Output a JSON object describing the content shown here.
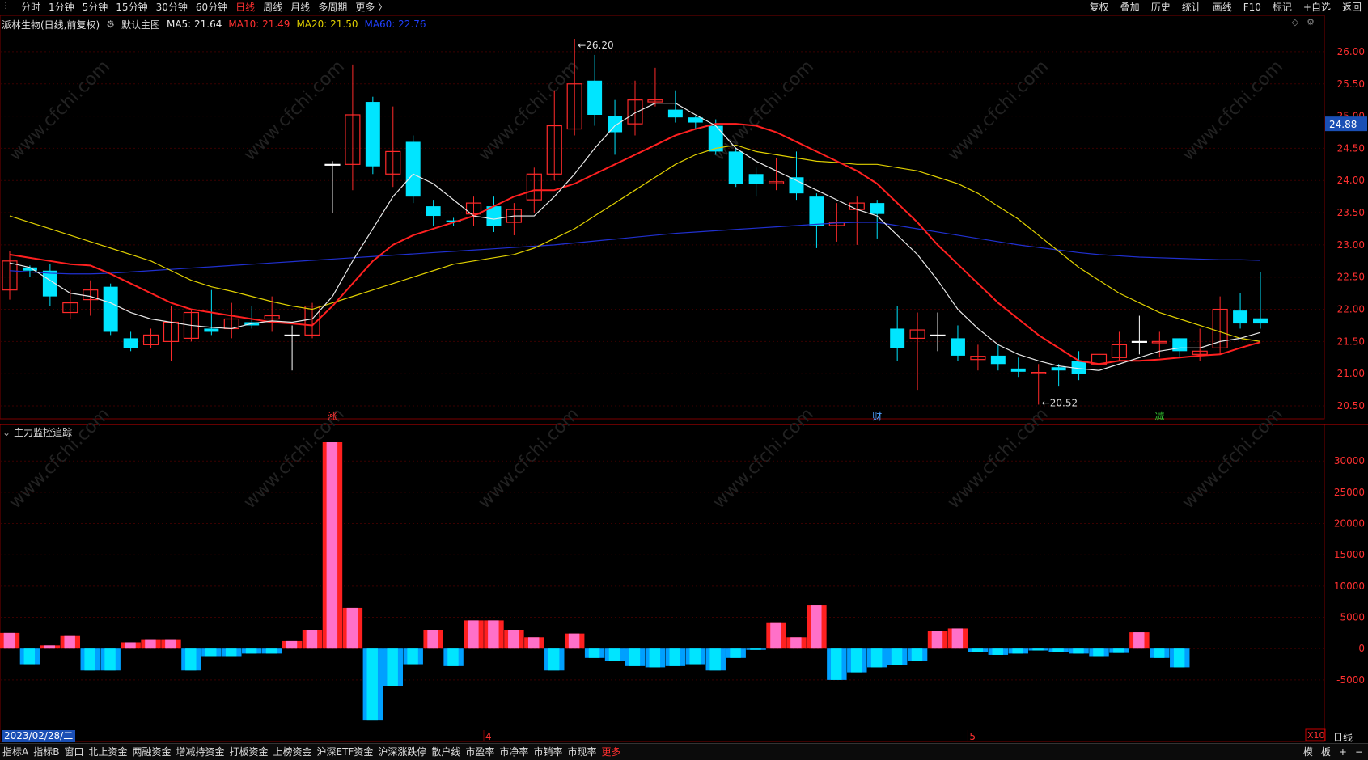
{
  "toolbar": {
    "left_items": [
      "分时",
      "1分钟",
      "5分钟",
      "15分钟",
      "30分钟",
      "60分钟",
      "日线",
      "周线",
      "月线",
      "多周期",
      "更多 〉"
    ],
    "active_item": "日线",
    "right_items": [
      "复权",
      "叠加",
      "历史",
      "统计",
      "画线",
      "F10",
      "标记",
      "+自选",
      "返回"
    ]
  },
  "legend": {
    "stock": "派林生物(日线,前复权)",
    "main": "默认主图",
    "ma5": "MA5: 21.64",
    "ma10": "MA10: 21.49",
    "ma20": "MA20: 21.50",
    "ma60": "MA60: 22.76"
  },
  "indicator_title": "主力监控追踪",
  "bottom_tabs": [
    "指标A",
    "指标B",
    "窗口",
    "北上资金",
    "两融资金",
    "增减持资金",
    "打板资金",
    "上榜资金",
    "沪深ETF资金",
    "沪深涨跌停",
    "散户线",
    "市盈率",
    "市净率",
    "市销率",
    "市现率",
    "更多"
  ],
  "bottom_right": [
    "模",
    "板",
    "+",
    "−"
  ],
  "date_label": "2023/02/28/二",
  "period_label": "日线",
  "x10_label": "X10",
  "colors": {
    "up": "#ff2a2a",
    "down": "#00e5ff",
    "ma5": "#e8e8e8",
    "ma10": "#ff2020",
    "ma20": "#e0d000",
    "ma60": "#2030d0",
    "bar_red": "#ff2020",
    "bar_pink": "#ff70c8",
    "bar_blue": "#00a0ff",
    "bar_cyan": "#00e5ff"
  },
  "chart_data": {
    "type": "candlestick",
    "price_axis": {
      "min": 20.4,
      "max": 26.2,
      "ticks": [
        "26.00",
        "25.50",
        "25.00",
        "24.50",
        "24.00",
        "23.50",
        "23.00",
        "22.50",
        "22.00",
        "21.50",
        "21.00",
        "20.50"
      ],
      "current": "24.88"
    },
    "annotations": {
      "high": "26.20",
      "low": "20.52"
    },
    "month_labels": [
      "4",
      "5"
    ],
    "event_markers": [
      "涨",
      "财",
      "减"
    ],
    "candles": [
      {
        "o": 22.3,
        "c": 22.75,
        "h": 22.9,
        "l": 22.15
      },
      {
        "o": 22.65,
        "c": 22.6,
        "h": 22.68,
        "l": 22.5
      },
      {
        "o": 22.6,
        "c": 22.2,
        "h": 22.7,
        "l": 22.05
      },
      {
        "o": 21.95,
        "c": 22.1,
        "h": 22.3,
        "l": 21.85
      },
      {
        "o": 22.15,
        "c": 22.3,
        "h": 22.45,
        "l": 21.9
      },
      {
        "o": 22.35,
        "c": 21.65,
        "h": 22.4,
        "l": 21.6
      },
      {
        "o": 21.55,
        "c": 21.4,
        "h": 21.65,
        "l": 21.35
      },
      {
        "o": 21.45,
        "c": 21.6,
        "h": 21.7,
        "l": 21.4
      },
      {
        "o": 21.5,
        "c": 21.8,
        "h": 22.05,
        "l": 21.2
      },
      {
        "o": 21.55,
        "c": 21.95,
        "h": 22.0,
        "l": 21.5
      },
      {
        "o": 21.7,
        "c": 21.65,
        "h": 22.3,
        "l": 21.6
      },
      {
        "o": 21.7,
        "c": 21.85,
        "h": 22.1,
        "l": 21.55
      },
      {
        "o": 21.8,
        "c": 21.75,
        "h": 22.05,
        "l": 21.7
      },
      {
        "o": 21.85,
        "c": 21.9,
        "h": 22.2,
        "l": 21.65
      },
      {
        "o": 21.6,
        "c": 21.6,
        "h": 21.75,
        "l": 21.05
      },
      {
        "o": 21.6,
        "c": 22.05,
        "h": 22.1,
        "l": 21.55
      },
      {
        "o": 24.25,
        "c": 24.25,
        "h": 24.3,
        "l": 23.5
      },
      {
        "o": 24.25,
        "c": 25.02,
        "h": 25.8,
        "l": 23.85
      },
      {
        "o": 25.22,
        "c": 24.22,
        "h": 25.3,
        "l": 24.1
      },
      {
        "o": 24.1,
        "c": 24.45,
        "h": 25.15,
        "l": 23.9
      },
      {
        "o": 24.6,
        "c": 23.75,
        "h": 24.7,
        "l": 23.65
      },
      {
        "o": 23.6,
        "c": 23.45,
        "h": 23.7,
        "l": 23.3
      },
      {
        "o": 23.38,
        "c": 23.35,
        "h": 23.42,
        "l": 23.3
      },
      {
        "o": 23.48,
        "c": 23.65,
        "h": 23.75,
        "l": 23.3
      },
      {
        "o": 23.6,
        "c": 23.3,
        "h": 23.75,
        "l": 23.2
      },
      {
        "o": 23.35,
        "c": 23.55,
        "h": 23.65,
        "l": 23.15
      },
      {
        "o": 23.7,
        "c": 24.1,
        "h": 24.2,
        "l": 23.5
      },
      {
        "o": 24.1,
        "c": 24.85,
        "h": 25.4,
        "l": 24.0
      },
      {
        "o": 24.8,
        "c": 25.5,
        "h": 26.2,
        "l": 24.7
      },
      {
        "o": 25.55,
        "c": 25.02,
        "h": 25.95,
        "l": 24.85
      },
      {
        "o": 25.0,
        "c": 24.75,
        "h": 25.25,
        "l": 24.4
      },
      {
        "o": 24.88,
        "c": 25.25,
        "h": 25.55,
        "l": 24.7
      },
      {
        "o": 25.22,
        "c": 25.25,
        "h": 25.75,
        "l": 25.15
      },
      {
        "o": 25.1,
        "c": 24.98,
        "h": 25.4,
        "l": 24.9
      },
      {
        "o": 24.98,
        "c": 24.9,
        "h": 25.0,
        "l": 24.8
      },
      {
        "o": 24.85,
        "c": 24.45,
        "h": 24.95,
        "l": 24.4
      },
      {
        "o": 24.45,
        "c": 23.95,
        "h": 24.5,
        "l": 23.9
      },
      {
        "o": 24.1,
        "c": 23.95,
        "h": 24.2,
        "l": 23.75
      },
      {
        "o": 23.95,
        "c": 23.98,
        "h": 24.35,
        "l": 23.85
      },
      {
        "o": 24.05,
        "c": 23.8,
        "h": 24.45,
        "l": 23.7
      },
      {
        "o": 23.75,
        "c": 23.3,
        "h": 23.8,
        "l": 22.95
      },
      {
        "o": 23.3,
        "c": 23.35,
        "h": 23.65,
        "l": 23.05
      },
      {
        "o": 23.55,
        "c": 23.65,
        "h": 23.75,
        "l": 23.0
      },
      {
        "o": 23.65,
        "c": 23.48,
        "h": 23.7,
        "l": 23.1
      },
      {
        "o": 21.7,
        "c": 21.4,
        "h": 22.05,
        "l": 21.2
      },
      {
        "o": 21.55,
        "c": 21.68,
        "h": 21.95,
        "l": 20.75
      },
      {
        "o": 21.6,
        "c": 21.6,
        "h": 21.95,
        "l": 21.35
      },
      {
        "o": 21.55,
        "c": 21.28,
        "h": 21.75,
        "l": 21.2
      },
      {
        "o": 21.22,
        "c": 21.27,
        "h": 21.45,
        "l": 21.05
      },
      {
        "o": 21.28,
        "c": 21.15,
        "h": 21.45,
        "l": 21.05
      },
      {
        "o": 21.08,
        "c": 21.03,
        "h": 21.25,
        "l": 20.95
      },
      {
        "o": 21.0,
        "c": 21.02,
        "h": 21.15,
        "l": 20.52
      },
      {
        "o": 21.1,
        "c": 21.05,
        "h": 21.15,
        "l": 20.8
      },
      {
        "o": 21.2,
        "c": 21.0,
        "h": 21.35,
        "l": 20.9
      },
      {
        "o": 21.15,
        "c": 21.3,
        "h": 21.35,
        "l": 21.05
      },
      {
        "o": 21.25,
        "c": 21.45,
        "h": 21.65,
        "l": 21.2
      },
      {
        "o": 21.5,
        "c": 21.5,
        "h": 21.9,
        "l": 21.3
      },
      {
        "o": 21.48,
        "c": 21.5,
        "h": 21.65,
        "l": 21.25
      },
      {
        "o": 21.55,
        "c": 21.35,
        "h": 21.55,
        "l": 21.25
      },
      {
        "o": 21.3,
        "c": 21.35,
        "h": 21.7,
        "l": 21.2
      },
      {
        "o": 21.4,
        "c": 22.0,
        "h": 22.2,
        "l": 21.3
      },
      {
        "o": 21.98,
        "c": 21.78,
        "h": 22.25,
        "l": 21.7
      },
      {
        "o": 21.86,
        "c": 21.78,
        "h": 22.58,
        "l": 21.7
      }
    ],
    "ma5": [
      22.72,
      22.65,
      22.45,
      22.25,
      22.2,
      22.1,
      21.95,
      21.85,
      21.8,
      21.75,
      21.72,
      21.7,
      21.78,
      21.82,
      21.8,
      21.85,
      22.2,
      22.75,
      23.25,
      23.75,
      24.1,
      23.95,
      23.7,
      23.45,
      23.4,
      23.45,
      23.45,
      23.75,
      24.1,
      24.5,
      24.85,
      25.05,
      25.2,
      25.2,
      25.02,
      24.85,
      24.5,
      24.3,
      24.15,
      24.0,
      23.85,
      23.7,
      23.55,
      23.45,
      23.15,
      22.85,
      22.45,
      22.0,
      21.7,
      21.45,
      21.3,
      21.2,
      21.12,
      21.08,
      21.05,
      21.15,
      21.25,
      21.35,
      21.4,
      21.4,
      21.5,
      21.55,
      21.64
    ],
    "ma10": [
      22.85,
      22.8,
      22.75,
      22.7,
      22.68,
      22.55,
      22.4,
      22.25,
      22.1,
      22.0,
      21.95,
      21.9,
      21.85,
      21.8,
      21.78,
      21.75,
      22.05,
      22.4,
      22.75,
      23.0,
      23.15,
      23.25,
      23.35,
      23.45,
      23.6,
      23.75,
      23.85,
      23.85,
      23.95,
      24.1,
      24.25,
      24.4,
      24.55,
      24.7,
      24.8,
      24.88,
      24.88,
      24.85,
      24.75,
      24.6,
      24.45,
      24.3,
      24.15,
      23.95,
      23.65,
      23.35,
      23.0,
      22.7,
      22.4,
      22.1,
      21.85,
      21.6,
      21.4,
      21.2,
      21.15,
      21.2,
      21.2,
      21.22,
      21.25,
      21.28,
      21.3,
      21.4,
      21.49
    ],
    "ma20": [
      23.45,
      23.35,
      23.25,
      23.15,
      23.05,
      22.95,
      22.85,
      22.75,
      22.6,
      22.45,
      22.35,
      22.28,
      22.2,
      22.12,
      22.05,
      22.0,
      22.1,
      22.2,
      22.3,
      22.4,
      22.5,
      22.6,
      22.7,
      22.75,
      22.8,
      22.85,
      22.95,
      23.1,
      23.25,
      23.45,
      23.65,
      23.85,
      24.05,
      24.25,
      24.4,
      24.5,
      24.55,
      24.45,
      24.4,
      24.35,
      24.3,
      24.28,
      24.25,
      24.25,
      24.2,
      24.15,
      24.05,
      23.95,
      23.8,
      23.6,
      23.4,
      23.15,
      22.9,
      22.65,
      22.45,
      22.25,
      22.1,
      21.95,
      21.85,
      21.75,
      21.65,
      21.55,
      21.5
    ],
    "ma60": [
      22.6,
      22.58,
      22.56,
      22.55,
      22.55,
      22.56,
      22.58,
      22.6,
      22.62,
      22.64,
      22.66,
      22.68,
      22.7,
      22.72,
      22.74,
      22.76,
      22.78,
      22.8,
      22.82,
      22.84,
      22.86,
      22.88,
      22.9,
      22.92,
      22.94,
      22.96,
      22.98,
      23.0,
      23.03,
      23.06,
      23.09,
      23.12,
      23.15,
      23.18,
      23.2,
      23.22,
      23.24,
      23.26,
      23.28,
      23.3,
      23.32,
      23.34,
      23.35,
      23.35,
      23.3,
      23.25,
      23.2,
      23.15,
      23.1,
      23.05,
      23.0,
      22.96,
      22.92,
      22.88,
      22.85,
      22.83,
      22.81,
      22.8,
      22.79,
      22.78,
      22.77,
      22.77,
      22.76
    ],
    "indicator": {
      "axis_ticks": [
        "30000",
        "25000",
        "20000",
        "15000",
        "10000",
        "5000",
        "0",
        "-5000"
      ],
      "axis_min": -12000,
      "axis_max": 33000,
      "values": [
        2500,
        -2500,
        500,
        2000,
        -3500,
        -3500,
        1000,
        1500,
        1500,
        -3500,
        -1200,
        -1200,
        -800,
        -800,
        1200,
        3000,
        33000,
        6500,
        -11500,
        -6000,
        -2500,
        3000,
        -2800,
        4500,
        4500,
        3000,
        1800,
        -3500,
        2400,
        -1500,
        -2000,
        -2800,
        -3000,
        -2800,
        -2500,
        -3500,
        -1500,
        -200,
        4200,
        1800,
        7000,
        -5000,
        -3800,
        -3000,
        -2600,
        -2000,
        2800,
        3200,
        -600,
        -1000,
        -800,
        -300,
        -500,
        -800,
        -1200,
        -700,
        2600,
        -1500,
        -3000
      ]
    }
  }
}
